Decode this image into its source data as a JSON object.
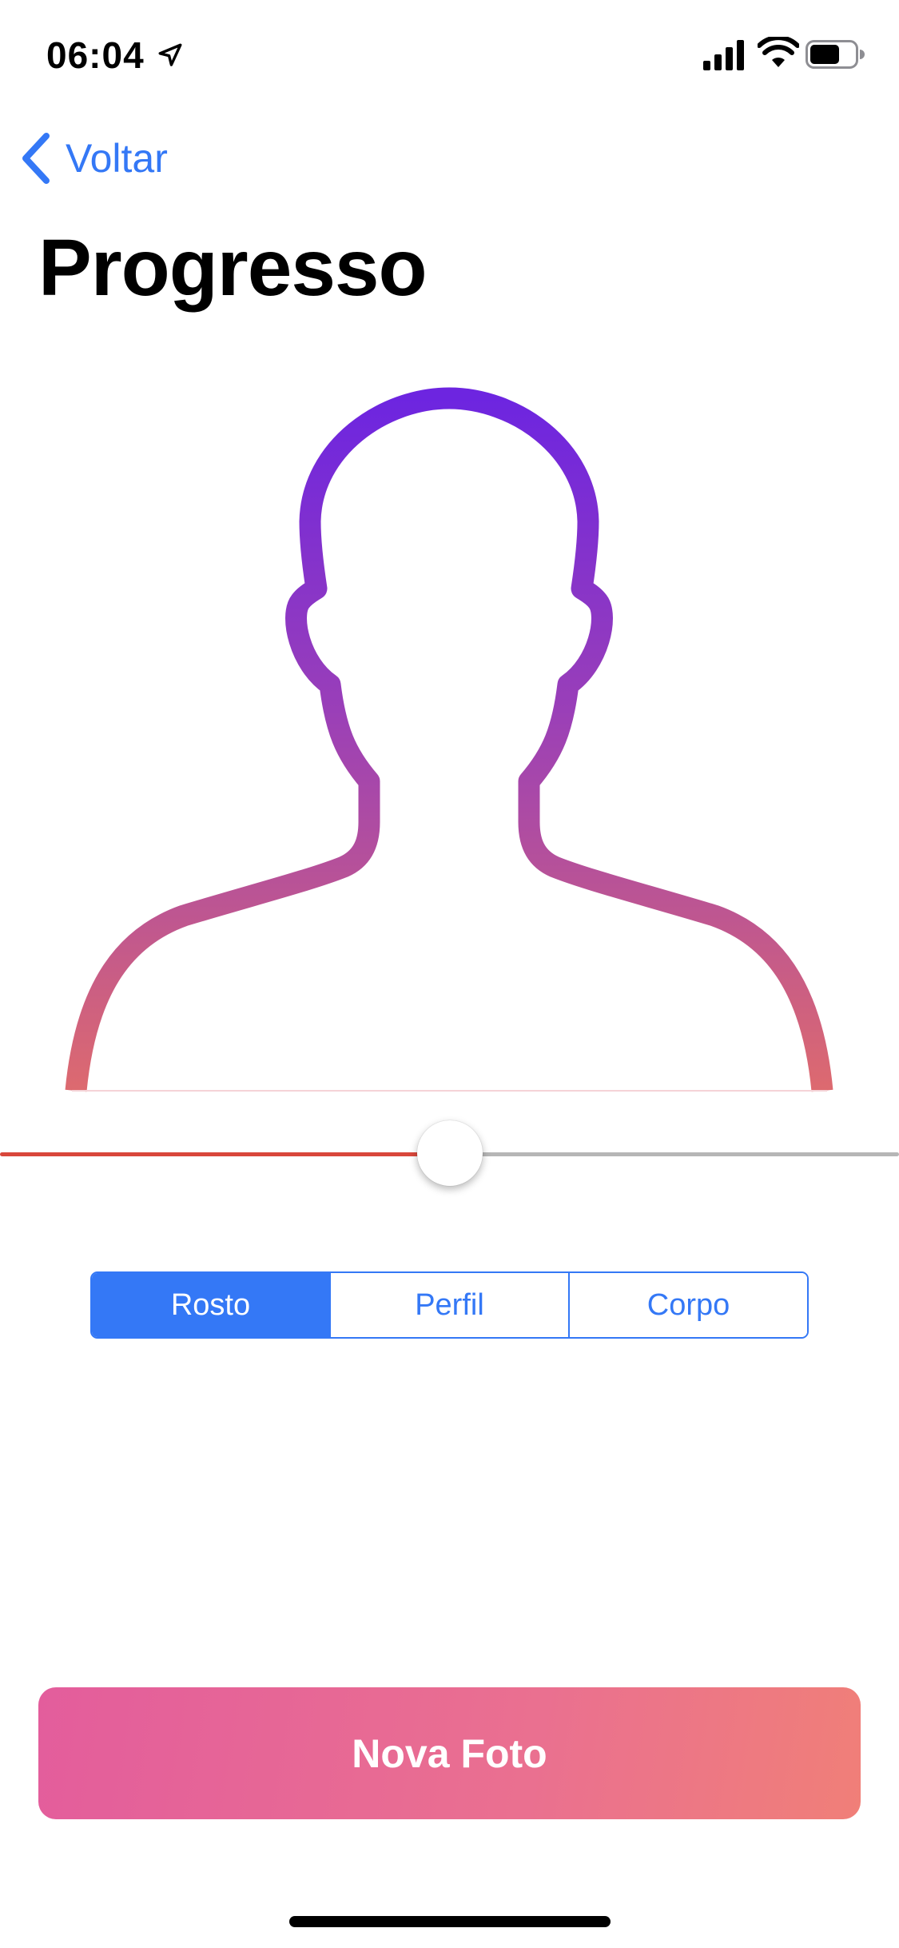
{
  "status_bar": {
    "time": "06:04",
    "icons": [
      "location-arrow-icon",
      "cellular-signal-icon",
      "wifi-icon",
      "battery-icon"
    ]
  },
  "nav": {
    "back_label": "Voltar",
    "back_icon": "chevron-left-icon"
  },
  "page": {
    "title": "Progresso"
  },
  "illustration": {
    "icon": "person-silhouette-icon",
    "gradient_top": "#6d25e0",
    "gradient_bottom": "#dd6a6f"
  },
  "slider": {
    "value": 0.5,
    "min_color": "#d9473b",
    "max_color": "#b6b6b6"
  },
  "segmented_control": {
    "selected_index": 0,
    "segments": [
      {
        "label": "Rosto"
      },
      {
        "label": "Perfil"
      },
      {
        "label": "Corpo"
      }
    ]
  },
  "primary_button": {
    "label": "Nova Foto"
  },
  "colors": {
    "accent": "#3478f6",
    "button_gradient_start": "#e35d9c",
    "button_gradient_end": "#f07f78"
  }
}
